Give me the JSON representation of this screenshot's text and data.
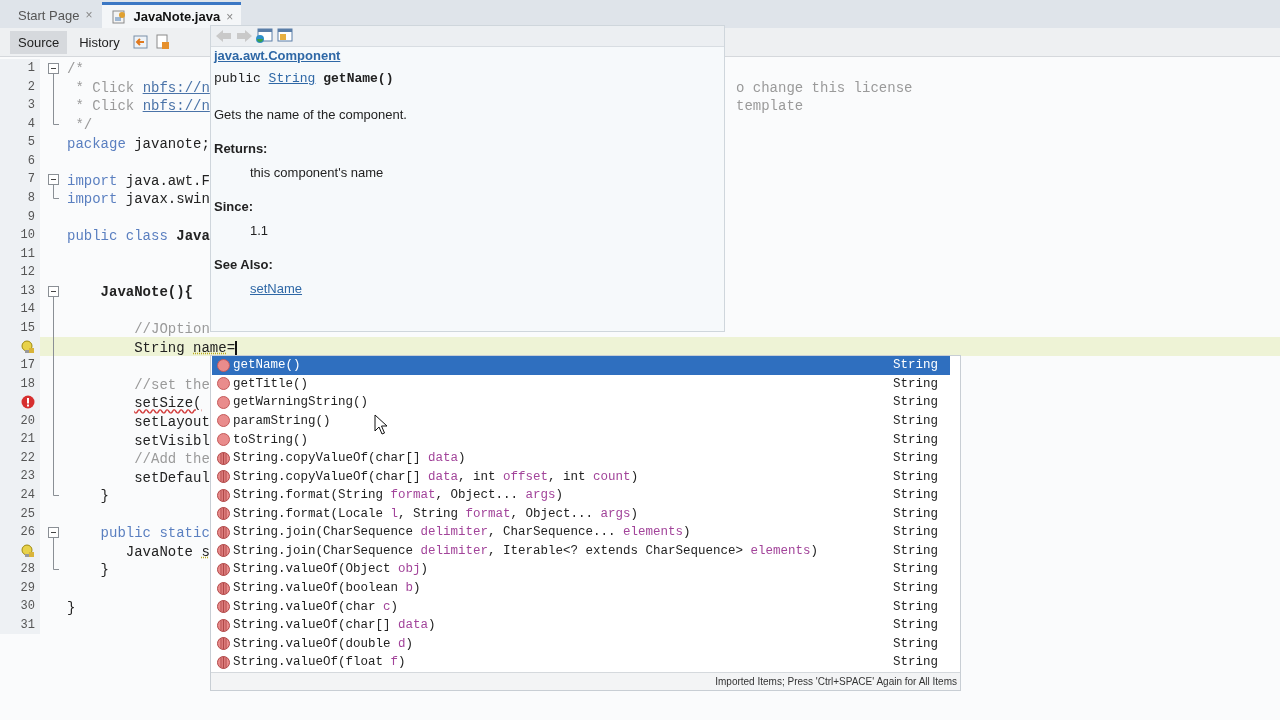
{
  "tabs": [
    {
      "label": "Start Page",
      "close": "×",
      "selected": false,
      "icon": false
    },
    {
      "label": "JavaNote.java",
      "close": "×",
      "selected": true,
      "icon": true
    }
  ],
  "toolbar": {
    "views": [
      {
        "label": "Source",
        "selected": true
      },
      {
        "label": "History",
        "selected": false
      }
    ]
  },
  "editor": {
    "lines": [
      {
        "number": "1",
        "fold": {
          "kind": "start"
        },
        "current": false,
        "segments": [
          {
            "text": "/*",
            "kind": "comment"
          }
        ]
      },
      {
        "number": "2",
        "fold": {
          "kind": "line"
        },
        "current": false,
        "segments": [
          {
            "text": " * Click ",
            "kind": "comment"
          },
          {
            "text": "nbfs://n",
            "kind": "link"
          }
        ],
        "right": "o change this license"
      },
      {
        "number": "3",
        "fold": {
          "kind": "line"
        },
        "current": false,
        "segments": [
          {
            "text": " * Click ",
            "kind": "comment"
          },
          {
            "text": "nbfs://n",
            "kind": "link"
          }
        ],
        "right": "template"
      },
      {
        "number": "4",
        "fold": {
          "kind": "end"
        },
        "current": false,
        "segments": [
          {
            "text": " */",
            "kind": "comment"
          }
        ]
      },
      {
        "number": "5",
        "current": false,
        "segments": [
          {
            "text": "package",
            "kind": "keyword"
          },
          {
            "text": " javanote;",
            "kind": "plain"
          }
        ]
      },
      {
        "number": "6",
        "current": false
      },
      {
        "number": "7",
        "fold": {
          "kind": "start"
        },
        "current": false,
        "segments": [
          {
            "text": "import",
            "kind": "keyword"
          },
          {
            "text": " java.awt.F",
            "kind": "plain"
          }
        ]
      },
      {
        "number": "8",
        "fold": {
          "kind": "end"
        },
        "current": false,
        "segments": [
          {
            "text": "import",
            "kind": "keyword"
          },
          {
            "text": " javax.swin",
            "kind": "plain"
          }
        ]
      },
      {
        "number": "9",
        "current": false
      },
      {
        "number": "10",
        "current": false,
        "segments": [
          {
            "text": "public class",
            "kind": "keyword"
          },
          {
            "text": " Java",
            "kind": "bold"
          }
        ]
      },
      {
        "number": "11",
        "current": false
      },
      {
        "number": "12",
        "current": false
      },
      {
        "number": "13",
        "fold": {
          "kind": "start"
        },
        "current": false,
        "segments": [
          {
            "text": "    JavaNote(){",
            "kind": "bold"
          }
        ]
      },
      {
        "number": "14",
        "fold": {
          "kind": "line"
        },
        "current": false
      },
      {
        "number": "15",
        "fold": {
          "kind": "line"
        },
        "current": false,
        "segments": [
          {
            "text": "        //JOption",
            "kind": "comment"
          }
        ]
      },
      {
        "marker": {
          "kind": "hint"
        },
        "fold": {
          "kind": "line"
        },
        "current": true,
        "segments": [
          {
            "text": "        String ",
            "kind": "plain"
          },
          {
            "text": "name",
            "kind": "warn"
          },
          {
            "text": "=",
            "kind": "plain"
          }
        ]
      },
      {
        "number": "17",
        "fold": {
          "kind": "line"
        },
        "current": false
      },
      {
        "number": "18",
        "fold": {
          "kind": "line"
        },
        "current": false,
        "segments": [
          {
            "text": "        //set the",
            "kind": "comment"
          }
        ]
      },
      {
        "marker": {
          "kind": "error"
        },
        "fold": {
          "kind": "line"
        },
        "current": false,
        "segments": [
          {
            "text": "        setSize(",
            "kind": "error"
          }
        ]
      },
      {
        "number": "20",
        "fold": {
          "kind": "line"
        },
        "current": false,
        "segments": [
          {
            "text": "        setLayout",
            "kind": "plain"
          }
        ]
      },
      {
        "number": "21",
        "fold": {
          "kind": "line"
        },
        "current": false,
        "segments": [
          {
            "text": "        setVisibl",
            "kind": "plain"
          }
        ]
      },
      {
        "number": "22",
        "fold": {
          "kind": "line"
        },
        "current": false,
        "segments": [
          {
            "text": "        //Add the",
            "kind": "comment"
          }
        ]
      },
      {
        "number": "23",
        "fold": {
          "kind": "line"
        },
        "current": false,
        "segments": [
          {
            "text": "        setDefaul",
            "kind": "plain"
          }
        ]
      },
      {
        "number": "24",
        "fold": {
          "kind": "end"
        },
        "current": false,
        "segments": [
          {
            "text": "    }",
            "kind": "plain"
          }
        ]
      },
      {
        "number": "25",
        "current": false
      },
      {
        "number": "26",
        "fold": {
          "kind": "start"
        },
        "current": false,
        "segments": [
          {
            "text": "    public static",
            "kind": "keyword"
          }
        ]
      },
      {
        "marker": {
          "kind": "hint"
        },
        "fold": {
          "kind": "line"
        },
        "current": false,
        "segments": [
          {
            "text": "       JavaNote ",
            "kind": "plain"
          },
          {
            "text": "s",
            "kind": "warn"
          }
        ]
      },
      {
        "number": "28",
        "fold": {
          "kind": "end"
        },
        "current": false,
        "segments": [
          {
            "text": "    }",
            "kind": "plain"
          }
        ]
      },
      {
        "number": "29",
        "current": false
      },
      {
        "number": "30",
        "current": false,
        "segments": [
          {
            "text": "}",
            "kind": "plain"
          }
        ]
      },
      {
        "number": "31",
        "current": false
      }
    ]
  },
  "doc_popup": {
    "title": "java.awt.Component",
    "signature": [
      {
        "text": "public ",
        "kind": "plain"
      },
      {
        "text": "String",
        "kind": "link"
      },
      {
        "text": " getName()",
        "kind": "bold"
      }
    ],
    "description": "Gets the name of the component.",
    "sections": [
      {
        "heading": "Returns:",
        "value": "this component's name",
        "kind": "text"
      },
      {
        "heading": "Since:",
        "value": "1.1",
        "kind": "text"
      },
      {
        "heading": "See Also:",
        "value": "setName",
        "kind": "link"
      }
    ]
  },
  "completion": {
    "items": [
      {
        "kind": "method",
        "selected": true,
        "segments": [
          {
            "text": "getName()",
            "kind": "name"
          }
        ],
        "type": "String"
      },
      {
        "kind": "method",
        "selected": false,
        "segments": [
          {
            "text": "getTitle()",
            "kind": "name"
          }
        ],
        "type": "String"
      },
      {
        "kind": "method",
        "selected": false,
        "segments": [
          {
            "text": "getWarningString()",
            "kind": "name"
          }
        ],
        "type": "String"
      },
      {
        "kind": "method",
        "selected": false,
        "segments": [
          {
            "text": "paramString()",
            "kind": "name"
          }
        ],
        "type": "String"
      },
      {
        "kind": "method",
        "selected": false,
        "segments": [
          {
            "text": "toString()",
            "kind": "name"
          }
        ],
        "type": "String"
      },
      {
        "kind": "static",
        "selected": false,
        "segments": [
          {
            "text": "String.copyValueOf(char[] ",
            "kind": "name"
          },
          {
            "text": "data",
            "kind": "param"
          },
          {
            "text": ")",
            "kind": "name"
          }
        ],
        "type": "String"
      },
      {
        "kind": "static",
        "selected": false,
        "segments": [
          {
            "text": "String.copyValueOf(char[] ",
            "kind": "name"
          },
          {
            "text": "data",
            "kind": "param"
          },
          {
            "text": ", int ",
            "kind": "name"
          },
          {
            "text": "offset",
            "kind": "param"
          },
          {
            "text": ", int ",
            "kind": "name"
          },
          {
            "text": "count",
            "kind": "param"
          },
          {
            "text": ")",
            "kind": "name"
          }
        ],
        "type": "String"
      },
      {
        "kind": "static",
        "selected": false,
        "segments": [
          {
            "text": "String.format(String ",
            "kind": "name"
          },
          {
            "text": "format",
            "kind": "param"
          },
          {
            "text": ", Object... ",
            "kind": "name"
          },
          {
            "text": "args",
            "kind": "param"
          },
          {
            "text": ")",
            "kind": "name"
          }
        ],
        "type": "String"
      },
      {
        "kind": "static",
        "selected": false,
        "segments": [
          {
            "text": "String.format(Locale ",
            "kind": "name"
          },
          {
            "text": "l",
            "kind": "param"
          },
          {
            "text": ", String ",
            "kind": "name"
          },
          {
            "text": "format",
            "kind": "param"
          },
          {
            "text": ", Object... ",
            "kind": "name"
          },
          {
            "text": "args",
            "kind": "param"
          },
          {
            "text": ")",
            "kind": "name"
          }
        ],
        "type": "String"
      },
      {
        "kind": "static",
        "selected": false,
        "segments": [
          {
            "text": "String.join(CharSequence ",
            "kind": "name"
          },
          {
            "text": "delimiter",
            "kind": "param"
          },
          {
            "text": ", CharSequence... ",
            "kind": "name"
          },
          {
            "text": "elements",
            "kind": "param"
          },
          {
            "text": ")",
            "kind": "name"
          }
        ],
        "type": "String"
      },
      {
        "kind": "static",
        "selected": false,
        "segments": [
          {
            "text": "String.join(CharSequence ",
            "kind": "name"
          },
          {
            "text": "delimiter",
            "kind": "param"
          },
          {
            "text": ", Iterable<? extends CharSequence> ",
            "kind": "name"
          },
          {
            "text": "elements",
            "kind": "param"
          },
          {
            "text": ")",
            "kind": "name"
          }
        ],
        "type": "String"
      },
      {
        "kind": "static",
        "selected": false,
        "segments": [
          {
            "text": "String.valueOf(Object ",
            "kind": "name"
          },
          {
            "text": "obj",
            "kind": "param"
          },
          {
            "text": ")",
            "kind": "name"
          }
        ],
        "type": "String"
      },
      {
        "kind": "static",
        "selected": false,
        "segments": [
          {
            "text": "String.valueOf(boolean ",
            "kind": "name"
          },
          {
            "text": "b",
            "kind": "param"
          },
          {
            "text": ")",
            "kind": "name"
          }
        ],
        "type": "String"
      },
      {
        "kind": "static",
        "selected": false,
        "segments": [
          {
            "text": "String.valueOf(char ",
            "kind": "name"
          },
          {
            "text": "c",
            "kind": "param"
          },
          {
            "text": ")",
            "kind": "name"
          }
        ],
        "type": "String"
      },
      {
        "kind": "static",
        "selected": false,
        "segments": [
          {
            "text": "String.valueOf(char[] ",
            "kind": "name"
          },
          {
            "text": "data",
            "kind": "param"
          },
          {
            "text": ")",
            "kind": "name"
          }
        ],
        "type": "String"
      },
      {
        "kind": "static",
        "selected": false,
        "segments": [
          {
            "text": "String.valueOf(double ",
            "kind": "name"
          },
          {
            "text": "d",
            "kind": "param"
          },
          {
            "text": ")",
            "kind": "name"
          }
        ],
        "type": "String"
      },
      {
        "kind": "static",
        "selected": false,
        "segments": [
          {
            "text": "String.valueOf(float ",
            "kind": "name"
          },
          {
            "text": "f",
            "kind": "param"
          },
          {
            "text": ")",
            "kind": "name"
          }
        ],
        "type": "String"
      }
    ],
    "footer": "Imported Items; Press 'Ctrl+SPACE' Again for All Items"
  }
}
